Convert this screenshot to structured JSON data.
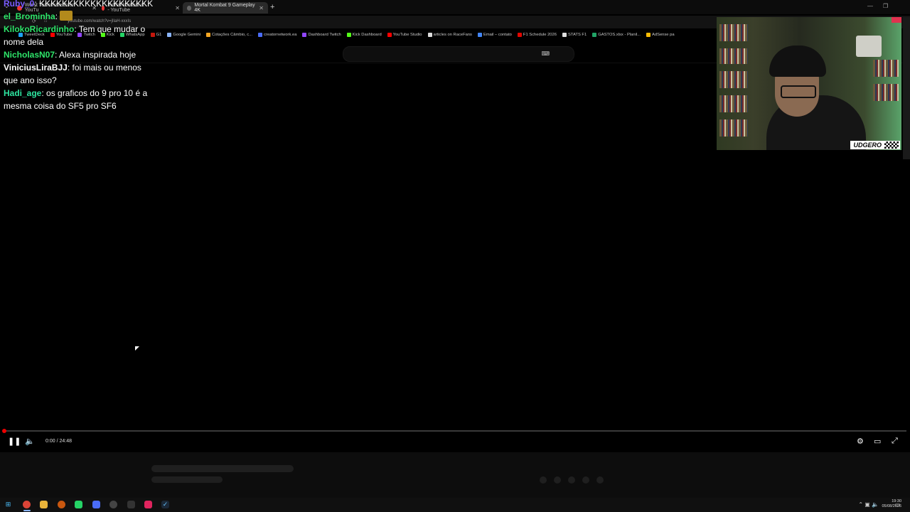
{
  "browser": {
    "tabs": [
      {
        "title": "Worst Teammate Ever - YouTu"
      },
      {
        "title": "mortal kombat ix - YouTube"
      },
      {
        "title": "Mortal Kombat 9 Gameplay 4K"
      }
    ],
    "url": "youtube.com/watch?v=jIlaH-xxxIs",
    "bookmarks": [
      {
        "label": "TweetDeck",
        "color": "#1da1f2"
      },
      {
        "label": "YouTube",
        "color": "#ff0000"
      },
      {
        "label": "Twitch",
        "color": "#9146ff"
      },
      {
        "label": "Kick",
        "color": "#53fc18"
      },
      {
        "label": "WhatsApp",
        "color": "#25d366"
      },
      {
        "label": "G1",
        "color": "#c4170c"
      },
      {
        "label": "Google Gemini",
        "color": "#8ab4f8"
      },
      {
        "label": "Cotações Câmbio, c...",
        "color": "#f5a623"
      },
      {
        "label": "creatornetwork.ea",
        "color": "#4a6cf7"
      },
      {
        "label": "Dashboard Twitch",
        "color": "#9146ff"
      },
      {
        "label": "Kick Dashboard",
        "color": "#53fc18"
      },
      {
        "label": "YouTube Studio",
        "color": "#ff0000"
      },
      {
        "label": "articles on RaceFans",
        "color": "#dddddd"
      },
      {
        "label": "Email – contato",
        "color": "#4285f4"
      },
      {
        "label": "F1 Schedule 2026",
        "color": "#e10600"
      },
      {
        "label": "STATS F1",
        "color": "#dddddd"
      },
      {
        "label": "GASTOS.xlsx - Planil...",
        "color": "#21a366"
      },
      {
        "label": "AdSense pa",
        "color": "#fbbc04"
      }
    ]
  },
  "chat": [
    {
      "user": "Ruby_0",
      "text": "KKKKKKKKKKKKKKKKKKKK",
      "color": "#7a5cff",
      "emote": false
    },
    {
      "user": "el_Brominha",
      "text": "",
      "color": "#2ee56a",
      "emote": true
    },
    {
      "user": "KilokoRicardinho",
      "text": "Tem que mudar o nome dela",
      "color": "#2ee56a",
      "emote": false
    },
    {
      "user": "NicholasN07",
      "text": "Alexa inspirada hoje",
      "color": "#2ee56a",
      "emote": false
    },
    {
      "user": "ViniciusLiraBJJ",
      "text": "foi mais ou menos que ano isso?",
      "color": "#ffffff",
      "emote": false
    },
    {
      "user": "Hadi_age",
      "text": "os graficos do 9 pro 10 é a mesma coisa do SF5 pro SF6",
      "color": "#2ee5a0",
      "emote": false
    }
  ],
  "player": {
    "time": "0:00 / 24:48",
    "progress": 0.0
  },
  "webcam": {
    "logo": "UDGERO"
  },
  "taskbar": {
    "clock_time": "19:30",
    "clock_date": "05/08/2026"
  },
  "accent_color": "#ff0000"
}
